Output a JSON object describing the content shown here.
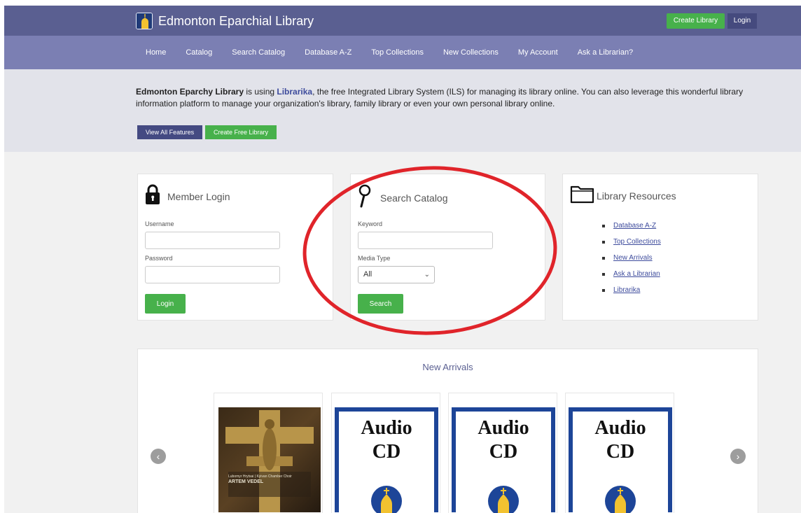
{
  "header": {
    "site_title": "Edmonton Eparchial Library",
    "create_library_label": "Create Library",
    "login_label": "Login"
  },
  "nav": {
    "items": [
      {
        "label": "Home"
      },
      {
        "label": "Catalog"
      },
      {
        "label": "Search Catalog"
      },
      {
        "label": "Database A-Z"
      },
      {
        "label": "Top Collections"
      },
      {
        "label": "New Collections"
      },
      {
        "label": "My Account"
      },
      {
        "label": "Ask a Librarian?"
      }
    ]
  },
  "intro": {
    "library_name": "Edmonton Eparchy Library",
    "text_1": " is using ",
    "product_name": "Librarika",
    "text_2": ", the free Integrated Library System (ILS) for managing its library online. You can also leverage this wonderful library information platform to manage your organization's library, family library or even your own personal library online.",
    "view_features_label": "View All Features",
    "create_free_label": "Create Free Library"
  },
  "member_login": {
    "title": "Member Login",
    "username_label": "Username",
    "username_value": "",
    "password_label": "Password",
    "password_value": "",
    "button_label": "Login"
  },
  "search_catalog": {
    "title": "Search Catalog",
    "keyword_label": "Keyword",
    "keyword_value": "",
    "media_type_label": "Media Type",
    "media_type_selected": "All",
    "button_label": "Search"
  },
  "library_resources": {
    "title": "Library Resources",
    "items": [
      {
        "label": "Database A-Z"
      },
      {
        "label": "Top Collections"
      },
      {
        "label": "New Arrivals"
      },
      {
        "label": "Ask a Librarian"
      },
      {
        "label": "Librarika"
      }
    ]
  },
  "new_arrivals": {
    "title": "New Arrivals",
    "items": [
      {
        "cover": "crucifix-album-art",
        "cover_caption_small": "Lubomyr Hrytsai | Kyivan Chamber Choir",
        "cover_caption_main": "ARTEM VEDEL"
      },
      {
        "cover": "audio-cd",
        "line1": "Audio",
        "line2": "CD"
      },
      {
        "cover": "audio-cd",
        "line1": "Audio",
        "line2": "CD"
      },
      {
        "cover": "audio-cd",
        "line1": "Audio",
        "line2": "CD"
      }
    ]
  },
  "colors": {
    "topbar": "#5a5f91",
    "navbar": "#7b7fb3",
    "intro_band": "#e2e3ea",
    "green": "#47b14b",
    "annotation_red": "#e0242a",
    "audio_blue": "#1d4598"
  },
  "icons": [
    "lock-icon",
    "magnifier-icon",
    "folder-icon",
    "chevron-down-icon",
    "arrow-left-icon",
    "arrow-right-icon"
  ]
}
